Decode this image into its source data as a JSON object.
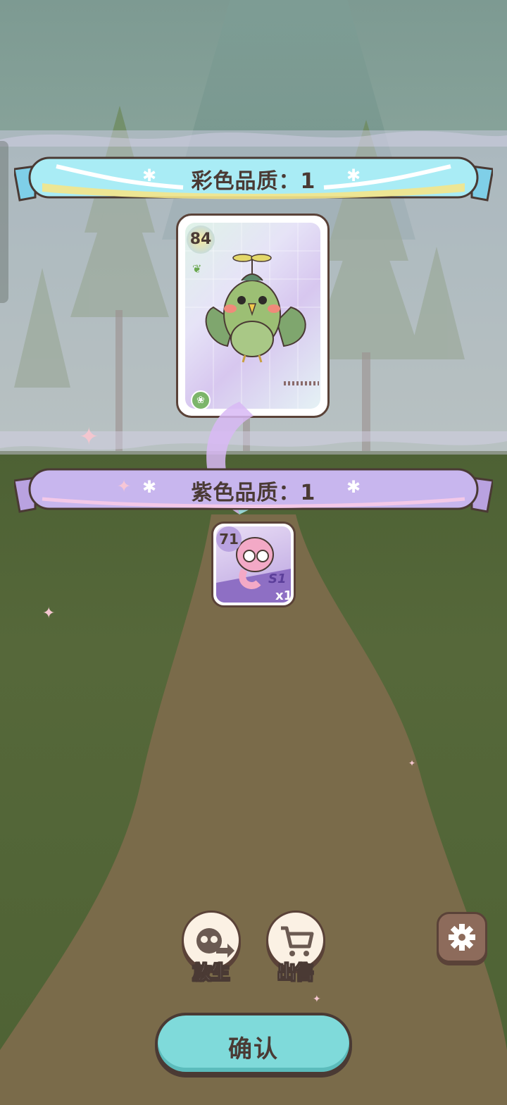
{
  "banners": {
    "rainbow": {
      "label": "彩色品质：1"
    },
    "purple": {
      "label": "紫色品质：1"
    }
  },
  "cards": {
    "featured": {
      "level": "84",
      "element_icon": "sprout-icon",
      "type_icon": "leaf-badge-icon",
      "character": "green-leaf-bird"
    },
    "small": {
      "level": "71",
      "count": "x1",
      "character": "pink-snake-with-glasses",
      "tag": "S1"
    }
  },
  "actions": {
    "release": {
      "label": "放生",
      "icon": "raccoon-release-icon"
    },
    "sell": {
      "label": "出售",
      "icon": "cart-icon"
    },
    "settings": {
      "icon": "gear-icon"
    },
    "confirm": {
      "label": "确认"
    }
  },
  "colors": {
    "confirm": "#7fdada",
    "rainbow_banner": "#a9ecf5",
    "purple_banner": "#c8b6ee",
    "outline": "#4a3a34"
  }
}
